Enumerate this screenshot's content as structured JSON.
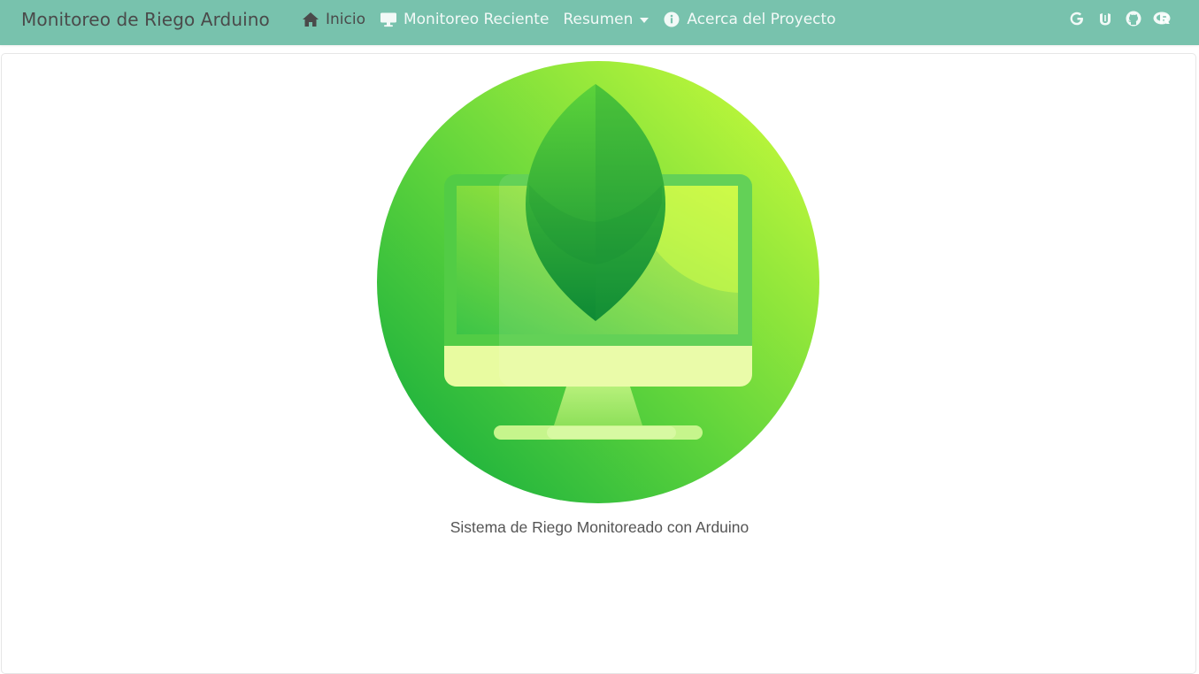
{
  "navbar": {
    "brand": "Monitoreo de Riego Arduino",
    "items": [
      {
        "label": "Inicio",
        "icon": "home-icon",
        "active": true
      },
      {
        "label": "Monitoreo Reciente",
        "icon": "desktop-icon",
        "active": false
      },
      {
        "label": "Resumen",
        "icon": "",
        "dropdown": true,
        "active": false
      },
      {
        "label": "Acerca del Proyecto",
        "icon": "info-circle-icon",
        "active": false
      }
    ],
    "social_icons": [
      "google-icon",
      "unity-icon",
      "github-icon",
      "r-project-icon"
    ],
    "background_color": "#78c2ad"
  },
  "main": {
    "image_icon": "monitor-leaf-logo",
    "caption": "Sistema de Riego Monitoreado con Arduino"
  }
}
